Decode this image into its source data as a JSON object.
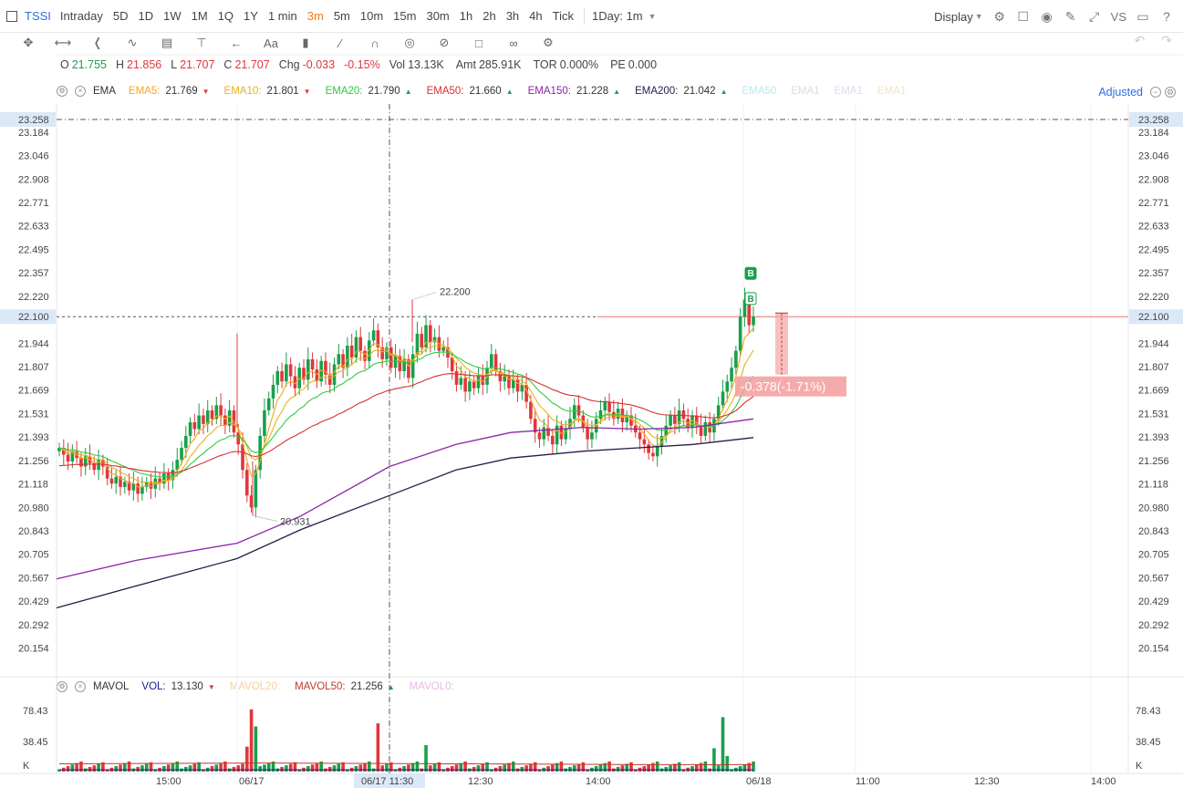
{
  "toolbar": {
    "symbol": "TSSI",
    "periods": [
      "Intraday",
      "5D",
      "1D",
      "1W",
      "1M",
      "1Q",
      "1Y",
      "1 min",
      "3m",
      "5m",
      "10m",
      "15m",
      "30m",
      "1h",
      "2h",
      "3h",
      "4h",
      "Tick"
    ],
    "active_period": "3m",
    "range_select": "1Day: 1m",
    "display_label": "Display",
    "right_icons": [
      "settings-icon",
      "layout-icon",
      "camera-icon",
      "pen-icon",
      "fullscreen-icon",
      "compare-icon",
      "book-icon",
      "help-icon"
    ],
    "vs_label": "VS"
  },
  "drawing_tools": [
    "crosshair-icon",
    "line-tool-icon",
    "fork-icon",
    "wave-icon",
    "fib-icon",
    "text-cursor-icon",
    "arrow-icon",
    "text-icon",
    "comment-icon",
    "ruler-icon",
    "magnet-icon",
    "eye-icon",
    "hide-icon",
    "trash-icon",
    "link-icon",
    "gear-icon"
  ],
  "ohlc": {
    "o_label": "O",
    "o": "21.755",
    "h_label": "H",
    "h": "21.856",
    "l_label": "L",
    "l": "21.707",
    "c_label": "C",
    "c": "21.707",
    "chg_label": "Chg",
    "chg": "-0.033",
    "chg_pct": "-0.15%",
    "vol_label": "Vol",
    "vol": "13.13K",
    "amt_label": "Amt",
    "amt": "285.91K",
    "tor_label": "TOR",
    "tor": "0.000%",
    "pe_label": "PE",
    "pe": "0.000"
  },
  "ema_row": {
    "name": "EMA",
    "items": [
      {
        "label": "EMA5:",
        "value": "21.769",
        "color": "#f5a623",
        "dir": "down"
      },
      {
        "label": "EMA10:",
        "value": "21.801",
        "color": "#e8b31c",
        "dir": "down"
      },
      {
        "label": "EMA20:",
        "value": "21.790",
        "color": "#2ecc40",
        "dir": "up"
      },
      {
        "label": "EMA50:",
        "value": "21.660",
        "color": "#d93030",
        "dir": "up"
      },
      {
        "label": "EMA150:",
        "value": "21.228",
        "color": "#8e24aa",
        "dir": "up"
      },
      {
        "label": "EMA200:",
        "value": "21.042",
        "color": "#2a1a4a",
        "dir": "up"
      }
    ],
    "faded": [
      "EMA50",
      "EMA1",
      "EMA1",
      "EMA1"
    ],
    "adjusted_label": "Adjusted"
  },
  "vol_row": {
    "name": "MAVOL",
    "items": [
      {
        "label": "VOL:",
        "value": "13.130",
        "color": "#1a1a8c",
        "dir": "down"
      },
      {
        "label": "MAVOL20:",
        "value": "",
        "color": "#f7cfa0",
        "dir": ""
      },
      {
        "label": "MAVOL50:",
        "value": "21.256",
        "color": "#c0392b",
        "dir": "up"
      },
      {
        "label": "MAVOL0:",
        "value": "",
        "color": "#e6b8e6",
        "dir": ""
      }
    ]
  },
  "price_axis": {
    "ticks": [
      "23.258",
      "23.184",
      "23.046",
      "22.908",
      "22.771",
      "22.633",
      "22.495",
      "22.357",
      "22.220",
      "22.100",
      "21.944",
      "21.807",
      "21.669",
      "21.531",
      "21.393",
      "21.256",
      "21.118",
      "20.980",
      "20.843",
      "20.705",
      "20.567",
      "20.429",
      "20.292",
      "20.154"
    ],
    "highlight_top": "23.258",
    "highlight_cursor": "22.100"
  },
  "volume_axis": {
    "ticks": [
      "78.43",
      "38.45",
      "K"
    ]
  },
  "time_axis": {
    "labels": [
      "15:00",
      "06/17",
      "12:30",
      "14:00",
      "06/18",
      "11:00",
      "12:30",
      "14:00"
    ],
    "cursor_label": "06/17 11:30"
  },
  "annotations": {
    "high_label": "22.200",
    "low_label": "20.931",
    "measure_label": "-0.378(-1.71%)",
    "buy_marker": "B"
  },
  "colors": {
    "up": "#18a04a",
    "down": "#e0373b",
    "accent": "#2a6fe0",
    "active": "#f07c1a"
  }
}
